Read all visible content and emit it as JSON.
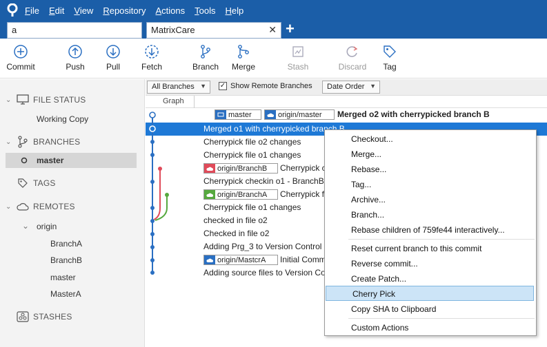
{
  "menu": [
    {
      "label": "File",
      "accel": "F"
    },
    {
      "label": "Edit",
      "accel": "E"
    },
    {
      "label": "View",
      "accel": "V"
    },
    {
      "label": "Repository",
      "accel": "R"
    },
    {
      "label": "Actions",
      "accel": "A"
    },
    {
      "label": "Tools",
      "accel": "T"
    },
    {
      "label": "Help",
      "accel": "H"
    }
  ],
  "tabs": {
    "search_value": "a",
    "active_tab": "MatrixCare",
    "close_glyph": "✕",
    "add_glyph": "+"
  },
  "toolbar": {
    "commit": "Commit",
    "push": "Push",
    "pull": "Pull",
    "fetch": "Fetch",
    "branch": "Branch",
    "merge": "Merge",
    "stash": "Stash",
    "discard": "Discard",
    "tag": "Tag"
  },
  "sidebar": {
    "file_status": "FILE STATUS",
    "working_copy": "Working Copy",
    "branches": "BRANCHES",
    "master": "master",
    "tags": "TAGS",
    "remotes": "REMOTES",
    "origin": "origin",
    "remote_branches": [
      "BranchA",
      "BranchB",
      "master",
      "MasterA"
    ],
    "stashes": "STASHES"
  },
  "filters": {
    "all_branches": "All Branches",
    "show_remote": "Show Remote Branches",
    "date_order": "Date Order"
  },
  "graph_header": "Graph",
  "refs": {
    "master": "master",
    "origin_master": "origin/master",
    "origin_branchb": "origin/BranchB",
    "origin_brancha": "origin/BranchA",
    "origin_mastera": "origin/MastcrA"
  },
  "commits": [
    {
      "message": "Merged o2 with cherrypicked branch B"
    },
    {
      "message": "Merged o1 with cherrypicked branch B"
    },
    {
      "message": "Cherrypick file o2 changes"
    },
    {
      "message": "Cherrypick file o1 changes"
    },
    {
      "message": "Cherrypick c"
    },
    {
      "message": "Cherrypick checkin o1 - BranchB"
    },
    {
      "message": "Cherrypick f"
    },
    {
      "message": "Cherrypick file o1 changes"
    },
    {
      "message": "checked in file o2"
    },
    {
      "message": "Checked in file o2"
    },
    {
      "message": "Adding Prg_3 to Version Control p"
    },
    {
      "message": "Initial Comm"
    },
    {
      "message": "Adding source files to Version Co"
    }
  ],
  "context_menu": [
    "Checkout...",
    "Merge...",
    "Rebase...",
    "Tag...",
    "Archive...",
    "Branch...",
    "Rebase children of 759fe44 interactively...",
    "Reset current branch to this commit",
    "Reverse commit...",
    "Create Patch...",
    "Cherry Pick",
    "Copy SHA to Clipboard",
    "Custom Actions"
  ],
  "colors": {
    "accent": "#1b5ea8",
    "selection": "#1e79d6",
    "graph_blue": "#2a6fc2",
    "graph_red": "#e04b5a",
    "graph_green": "#56a93f"
  }
}
